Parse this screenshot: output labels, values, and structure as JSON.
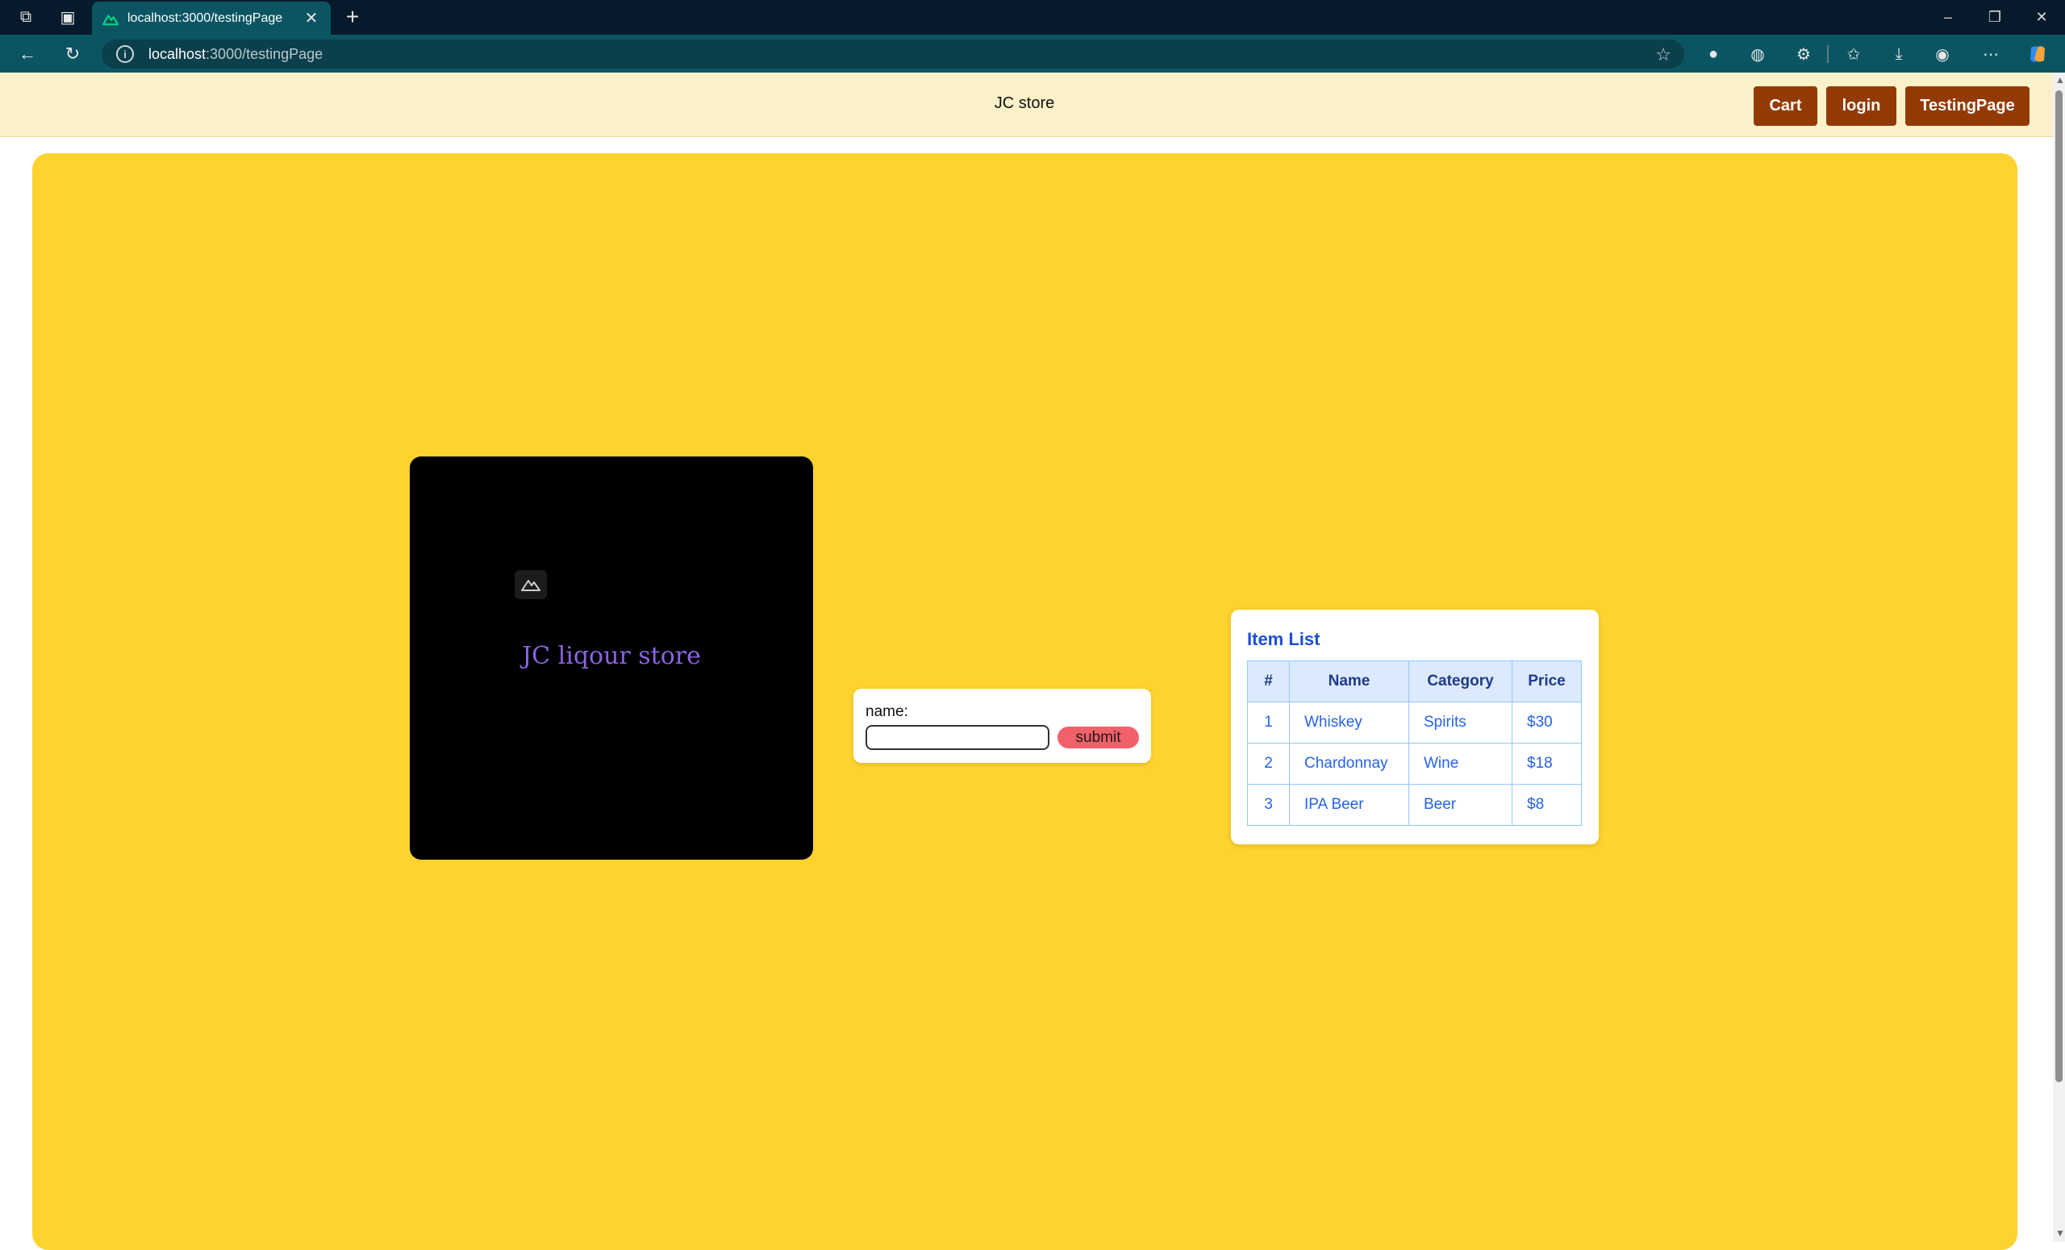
{
  "browser": {
    "tab_title": "localhost:3000/testingPage",
    "url_host": "localhost",
    "url_path": ":3000/testingPage"
  },
  "header": {
    "site_title": "JC store",
    "buttons": {
      "cart": "Cart",
      "login": "login",
      "testing": "TestingPage"
    }
  },
  "hero": {
    "text": "JC liqour store"
  },
  "form": {
    "label": "name:",
    "input_value": "",
    "submit_label": "submit"
  },
  "item_list": {
    "title": "Item List",
    "columns": [
      "#",
      "Name",
      "Category",
      "Price"
    ],
    "rows": [
      [
        "1",
        "Whiskey",
        "Spirits",
        "$30"
      ],
      [
        "2",
        "Chardonnay",
        "Wine",
        "$18"
      ],
      [
        "3",
        "IPA Beer",
        "Beer",
        "$8"
      ]
    ]
  },
  "colors": {
    "stage_bg": "#fed32f",
    "header_bg": "#fcf1c8",
    "button_bg": "#933a04",
    "submit_bg": "#f2606a",
    "hero_text": "#8a63e0",
    "table_text": "#2563eb"
  }
}
